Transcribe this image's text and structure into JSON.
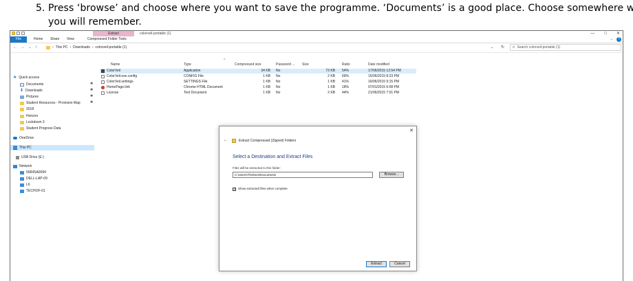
{
  "instruction": {
    "number": "5.",
    "line1": "Press ‘browse’ and choose where you want to save the programme. ‘Documents’ is a good place. Choose somewhere where",
    "line2": "you will remember."
  },
  "window": {
    "title": "colorveil-portable (1)",
    "context_tab": "Extract",
    "context_tab_group": "Compressed Folder Tools",
    "controls": {
      "minimize": "—",
      "maximize": "□",
      "close": "✕"
    }
  },
  "ribbon": {
    "tabs": [
      "File",
      "Home",
      "Share",
      "View"
    ],
    "help": "?",
    "expand": "⌄"
  },
  "addressbar": {
    "nav": {
      "back": "←",
      "forward": "→",
      "recent": "⌄",
      "up": "↑"
    },
    "crumbs": [
      "This PC",
      "Downloads",
      "colorveil-portable (1)"
    ],
    "sep": "›",
    "dropdown": "⌄",
    "refresh": "↻",
    "search_placeholder": "Search colorveil-portable (1)"
  },
  "navpane": {
    "items": [
      {
        "label": "Quick access",
        "icon": "star-icon",
        "pinned": false
      },
      {
        "label": "Documents",
        "icon": "documents-icon",
        "pinned": true
      },
      {
        "label": "Downloads",
        "icon": "downloads-icon",
        "pinned": true
      },
      {
        "label": "Pictures",
        "icon": "pictures-icon",
        "pinned": true
      },
      {
        "label": "Student Resources - Provision Map",
        "icon": "folder-icon",
        "pinned": true
      },
      {
        "label": "2018",
        "icon": "folder-icon",
        "pinned": false
      },
      {
        "label": "Horizon",
        "icon": "folder-icon",
        "pinned": false
      },
      {
        "label": "Lockdown 3",
        "icon": "folder-icon",
        "pinned": false
      },
      {
        "label": "Student Progress Data",
        "icon": "folder-icon",
        "pinned": false
      },
      {
        "label": "OneDrive",
        "icon": "onedrive-icon",
        "pinned": false
      },
      {
        "label": "This PC",
        "icon": "this-pc-icon",
        "pinned": false,
        "selected": true
      },
      {
        "label": "USB Drive (E:)",
        "icon": "usb-drive-icon",
        "pinned": false
      },
      {
        "label": "Network",
        "icon": "network-icon",
        "pinned": false
      },
      {
        "label": "5684SA0094",
        "icon": "computer-icon",
        "pinned": false
      },
      {
        "label": "DELL-LAP-09",
        "icon": "computer-icon",
        "pinned": false
      },
      {
        "label": "L6",
        "icon": "computer-icon",
        "pinned": false
      },
      {
        "label": "TECHOF-01",
        "icon": "computer-icon",
        "pinned": false
      }
    ],
    "pin_glyph": "✱"
  },
  "files": {
    "sort_glyph": "^",
    "headers": {
      "name": "Name",
      "type": "Type",
      "compressed": "Compressed size",
      "password": "Password ...",
      "size": "Size",
      "ratio": "Ratio",
      "date": "Date modified"
    },
    "rows": [
      {
        "name": "ColorVeil",
        "type": "Application",
        "compressed": "34 KB",
        "password": "No",
        "size": "73 KB",
        "ratio": "54%",
        "date": "17/06/2015 12:54 PM",
        "icon": "app-icon",
        "selected": true
      },
      {
        "name": "ColorVeil.exe.config",
        "type": "CONFIG File",
        "compressed": "1 KB",
        "password": "No",
        "size": "2 KB",
        "ratio": "69%",
        "date": "15/06/2015 8:23 PM",
        "icon": "config-file-icon"
      },
      {
        "name": "ColorVeil.settings",
        "type": "SETTINGS File",
        "compressed": "1 KB",
        "password": "No",
        "size": "1 KB",
        "ratio": "41%",
        "date": "16/06/2015 9:15 PM",
        "icon": "settings-file-icon"
      },
      {
        "name": "HomePage.link",
        "type": "Chrome HTML Document",
        "compressed": "1 KB",
        "password": "No",
        "size": "1 KB",
        "ratio": "18%",
        "date": "07/01/2015 6:08 PM",
        "icon": "chrome-html-icon"
      },
      {
        "name": "License",
        "type": "Text Document",
        "compressed": "1 KB",
        "password": "No",
        "size": "2 KB",
        "ratio": "44%",
        "date": "21/06/2015 7:01 PM",
        "icon": "text-document-icon"
      }
    ]
  },
  "dialog": {
    "title": "Extract Compressed (Zipped) Folders",
    "heading": "Select a Destination and Extract Files",
    "label": "Files will be extracted to this folder:",
    "path_value": "C:\\Users\\Tholmes\\Documents",
    "browse": "Browse...",
    "checkbox_label": "Show extracted files when complete",
    "checkbox_mark": "✓",
    "extract": "Extract",
    "cancel": "Cancel",
    "close": "✕",
    "back": "←"
  }
}
